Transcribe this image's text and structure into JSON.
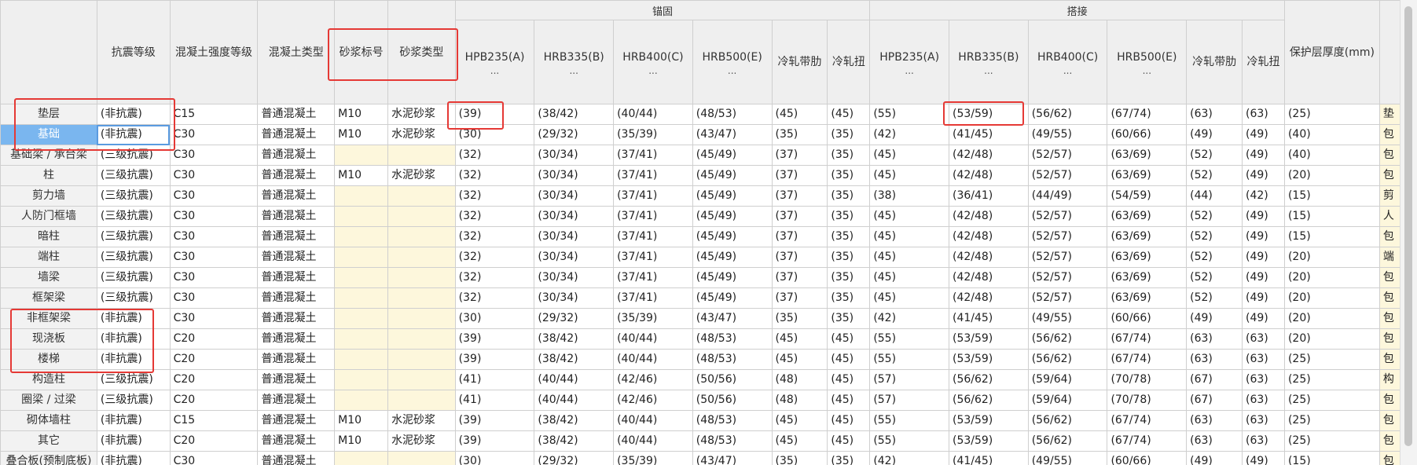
{
  "header": {
    "anchor_group": "锚固",
    "lap_group": "搭接",
    "columns": {
      "seismic": "抗震等级",
      "concrete_grade": "混凝土强度等级",
      "concrete_type": "混凝土类型",
      "mortar_grade": "砂浆标号",
      "mortar_type": "砂浆类型",
      "a_hpb235": "HPB235(A)",
      "a_hrb335": "HRB335(B)",
      "a_hrb400": "HRB400(C)",
      "a_hrb500": "HRB500(E)",
      "a_cold_ribbed": "冷轧带肋",
      "a_cold_twisted": "冷轧扭",
      "l_hpb235": "HPB235(A)",
      "l_hrb335": "HRB335(B)",
      "l_hrb400": "HRB400(C)",
      "l_hrb500": "HRB500(E)",
      "l_cold_ribbed": "冷轧带肋",
      "l_cold_twisted": "冷轧扭",
      "cover": "保护层厚度(mm)"
    },
    "ellipsis": "..."
  },
  "rows": [
    {
      "name": "垫层",
      "seismic": "(非抗震)",
      "cg": "C15",
      "ct": "普通混凝土",
      "mg": "M10",
      "mt": "水泥砂浆",
      "a1": "(39)",
      "a2": "(38/42)",
      "a3": "(40/44)",
      "a4": "(48/53)",
      "a5": "(45)",
      "a6": "(45)",
      "l1": "(55)",
      "l2": "(53/59)",
      "l3": "(56/62)",
      "l4": "(67/74)",
      "l5": "(63)",
      "l6": "(63)",
      "cover": "(25)",
      "last": "垫"
    },
    {
      "name": "基础",
      "seismic": "(非抗震)",
      "cg": "C30",
      "ct": "普通混凝土",
      "mg": "M10",
      "mt": "水泥砂浆",
      "a1": "(30)",
      "a2": "(29/32)",
      "a3": "(35/39)",
      "a4": "(43/47)",
      "a5": "(35)",
      "a6": "(35)",
      "l1": "(42)",
      "l2": "(41/45)",
      "l3": "(49/55)",
      "l4": "(60/66)",
      "l5": "(49)",
      "l6": "(49)",
      "cover": "(40)",
      "last": "包"
    },
    {
      "name": "基础梁 / 承台梁",
      "seismic": "(三级抗震)",
      "cg": "C30",
      "ct": "普通混凝土",
      "mg": "",
      "mt": "",
      "a1": "(32)",
      "a2": "(30/34)",
      "a3": "(37/41)",
      "a4": "(45/49)",
      "a5": "(37)",
      "a6": "(35)",
      "l1": "(45)",
      "l2": "(42/48)",
      "l3": "(52/57)",
      "l4": "(63/69)",
      "l5": "(52)",
      "l6": "(49)",
      "cover": "(40)",
      "last": "包"
    },
    {
      "name": "柱",
      "seismic": "(三级抗震)",
      "cg": "C30",
      "ct": "普通混凝土",
      "mg": "M10",
      "mt": "水泥砂浆",
      "a1": "(32)",
      "a2": "(30/34)",
      "a3": "(37/41)",
      "a4": "(45/49)",
      "a5": "(37)",
      "a6": "(35)",
      "l1": "(45)",
      "l2": "(42/48)",
      "l3": "(52/57)",
      "l4": "(63/69)",
      "l5": "(52)",
      "l6": "(49)",
      "cover": "(20)",
      "last": "包"
    },
    {
      "name": "剪力墙",
      "seismic": "(三级抗震)",
      "cg": "C30",
      "ct": "普通混凝土",
      "mg": "",
      "mt": "",
      "a1": "(32)",
      "a2": "(30/34)",
      "a3": "(37/41)",
      "a4": "(45/49)",
      "a5": "(37)",
      "a6": "(35)",
      "l1": "(38)",
      "l2": "(36/41)",
      "l3": "(44/49)",
      "l4": "(54/59)",
      "l5": "(44)",
      "l6": "(42)",
      "cover": "(15)",
      "last": "剪"
    },
    {
      "name": "人防门框墙",
      "seismic": "(三级抗震)",
      "cg": "C30",
      "ct": "普通混凝土",
      "mg": "",
      "mt": "",
      "a1": "(32)",
      "a2": "(30/34)",
      "a3": "(37/41)",
      "a4": "(45/49)",
      "a5": "(37)",
      "a6": "(35)",
      "l1": "(45)",
      "l2": "(42/48)",
      "l3": "(52/57)",
      "l4": "(63/69)",
      "l5": "(52)",
      "l6": "(49)",
      "cover": "(15)",
      "last": "人"
    },
    {
      "name": "暗柱",
      "seismic": "(三级抗震)",
      "cg": "C30",
      "ct": "普通混凝土",
      "mg": "",
      "mt": "",
      "a1": "(32)",
      "a2": "(30/34)",
      "a3": "(37/41)",
      "a4": "(45/49)",
      "a5": "(37)",
      "a6": "(35)",
      "l1": "(45)",
      "l2": "(42/48)",
      "l3": "(52/57)",
      "l4": "(63/69)",
      "l5": "(52)",
      "l6": "(49)",
      "cover": "(15)",
      "last": "包"
    },
    {
      "name": "端柱",
      "seismic": "(三级抗震)",
      "cg": "C30",
      "ct": "普通混凝土",
      "mg": "",
      "mt": "",
      "a1": "(32)",
      "a2": "(30/34)",
      "a3": "(37/41)",
      "a4": "(45/49)",
      "a5": "(37)",
      "a6": "(35)",
      "l1": "(45)",
      "l2": "(42/48)",
      "l3": "(52/57)",
      "l4": "(63/69)",
      "l5": "(52)",
      "l6": "(49)",
      "cover": "(20)",
      "last": "端"
    },
    {
      "name": "墙梁",
      "seismic": "(三级抗震)",
      "cg": "C30",
      "ct": "普通混凝土",
      "mg": "",
      "mt": "",
      "a1": "(32)",
      "a2": "(30/34)",
      "a3": "(37/41)",
      "a4": "(45/49)",
      "a5": "(37)",
      "a6": "(35)",
      "l1": "(45)",
      "l2": "(42/48)",
      "l3": "(52/57)",
      "l4": "(63/69)",
      "l5": "(52)",
      "l6": "(49)",
      "cover": "(20)",
      "last": "包"
    },
    {
      "name": "框架梁",
      "seismic": "(三级抗震)",
      "cg": "C30",
      "ct": "普通混凝土",
      "mg": "",
      "mt": "",
      "a1": "(32)",
      "a2": "(30/34)",
      "a3": "(37/41)",
      "a4": "(45/49)",
      "a5": "(37)",
      "a6": "(35)",
      "l1": "(45)",
      "l2": "(42/48)",
      "l3": "(52/57)",
      "l4": "(63/69)",
      "l5": "(52)",
      "l6": "(49)",
      "cover": "(20)",
      "last": "包"
    },
    {
      "name": "非框架梁",
      "seismic": "(非抗震)",
      "cg": "C30",
      "ct": "普通混凝土",
      "mg": "",
      "mt": "",
      "a1": "(30)",
      "a2": "(29/32)",
      "a3": "(35/39)",
      "a4": "(43/47)",
      "a5": "(35)",
      "a6": "(35)",
      "l1": "(42)",
      "l2": "(41/45)",
      "l3": "(49/55)",
      "l4": "(60/66)",
      "l5": "(49)",
      "l6": "(49)",
      "cover": "(20)",
      "last": "包"
    },
    {
      "name": "现浇板",
      "seismic": "(非抗震)",
      "cg": "C20",
      "ct": "普通混凝土",
      "mg": "",
      "mt": "",
      "a1": "(39)",
      "a2": "(38/42)",
      "a3": "(40/44)",
      "a4": "(48/53)",
      "a5": "(45)",
      "a6": "(45)",
      "l1": "(55)",
      "l2": "(53/59)",
      "l3": "(56/62)",
      "l4": "(67/74)",
      "l5": "(63)",
      "l6": "(63)",
      "cover": "(20)",
      "last": "包"
    },
    {
      "name": "楼梯",
      "seismic": "(非抗震)",
      "cg": "C20",
      "ct": "普通混凝土",
      "mg": "",
      "mt": "",
      "a1": "(39)",
      "a2": "(38/42)",
      "a3": "(40/44)",
      "a4": "(48/53)",
      "a5": "(45)",
      "a6": "(45)",
      "l1": "(55)",
      "l2": "(53/59)",
      "l3": "(56/62)",
      "l4": "(67/74)",
      "l5": "(63)",
      "l6": "(63)",
      "cover": "(25)",
      "last": "包"
    },
    {
      "name": "构造柱",
      "seismic": "(三级抗震)",
      "cg": "C20",
      "ct": "普通混凝土",
      "mg": "",
      "mt": "",
      "a1": "(41)",
      "a2": "(40/44)",
      "a3": "(42/46)",
      "a4": "(50/56)",
      "a5": "(48)",
      "a6": "(45)",
      "l1": "(57)",
      "l2": "(56/62)",
      "l3": "(59/64)",
      "l4": "(70/78)",
      "l5": "(67)",
      "l6": "(63)",
      "cover": "(25)",
      "last": "构"
    },
    {
      "name": "圈梁 / 过梁",
      "seismic": "(三级抗震)",
      "cg": "C20",
      "ct": "普通混凝土",
      "mg": "",
      "mt": "",
      "a1": "(41)",
      "a2": "(40/44)",
      "a3": "(42/46)",
      "a4": "(50/56)",
      "a5": "(48)",
      "a6": "(45)",
      "l1": "(57)",
      "l2": "(56/62)",
      "l3": "(59/64)",
      "l4": "(70/78)",
      "l5": "(67)",
      "l6": "(63)",
      "cover": "(25)",
      "last": "包"
    },
    {
      "name": "砌体墙柱",
      "seismic": "(非抗震)",
      "cg": "C15",
      "ct": "普通混凝土",
      "mg": "M10",
      "mt": "水泥砂浆",
      "a1": "(39)",
      "a2": "(38/42)",
      "a3": "(40/44)",
      "a4": "(48/53)",
      "a5": "(45)",
      "a6": "(45)",
      "l1": "(55)",
      "l2": "(53/59)",
      "l3": "(56/62)",
      "l4": "(67/74)",
      "l5": "(63)",
      "l6": "(63)",
      "cover": "(25)",
      "last": "包"
    },
    {
      "name": "其它",
      "seismic": "(非抗震)",
      "cg": "C20",
      "ct": "普通混凝土",
      "mg": "M10",
      "mt": "水泥砂浆",
      "a1": "(39)",
      "a2": "(38/42)",
      "a3": "(40/44)",
      "a4": "(48/53)",
      "a5": "(45)",
      "a6": "(45)",
      "l1": "(55)",
      "l2": "(53/59)",
      "l3": "(56/62)",
      "l4": "(67/74)",
      "l5": "(63)",
      "l6": "(63)",
      "cover": "(25)",
      "last": "包"
    },
    {
      "name": "叠合板(预制底板)",
      "seismic": "(非抗震)",
      "cg": "C30",
      "ct": "普通混凝土",
      "mg": "",
      "mt": "",
      "a1": "(30)",
      "a2": "(29/32)",
      "a3": "(35/39)",
      "a4": "(43/47)",
      "a5": "(35)",
      "a6": "(35)",
      "l1": "(42)",
      "l2": "(41/45)",
      "l3": "(49/55)",
      "l4": "(60/66)",
      "l5": "(49)",
      "l6": "(49)",
      "cover": "(15)",
      "last": "包"
    }
  ],
  "selected_row": "基础",
  "colors": {
    "highlight_header": "#7ab6ef",
    "annotation_red": "#e53935",
    "empty_cell_yellow": "#fdf7dc"
  }
}
